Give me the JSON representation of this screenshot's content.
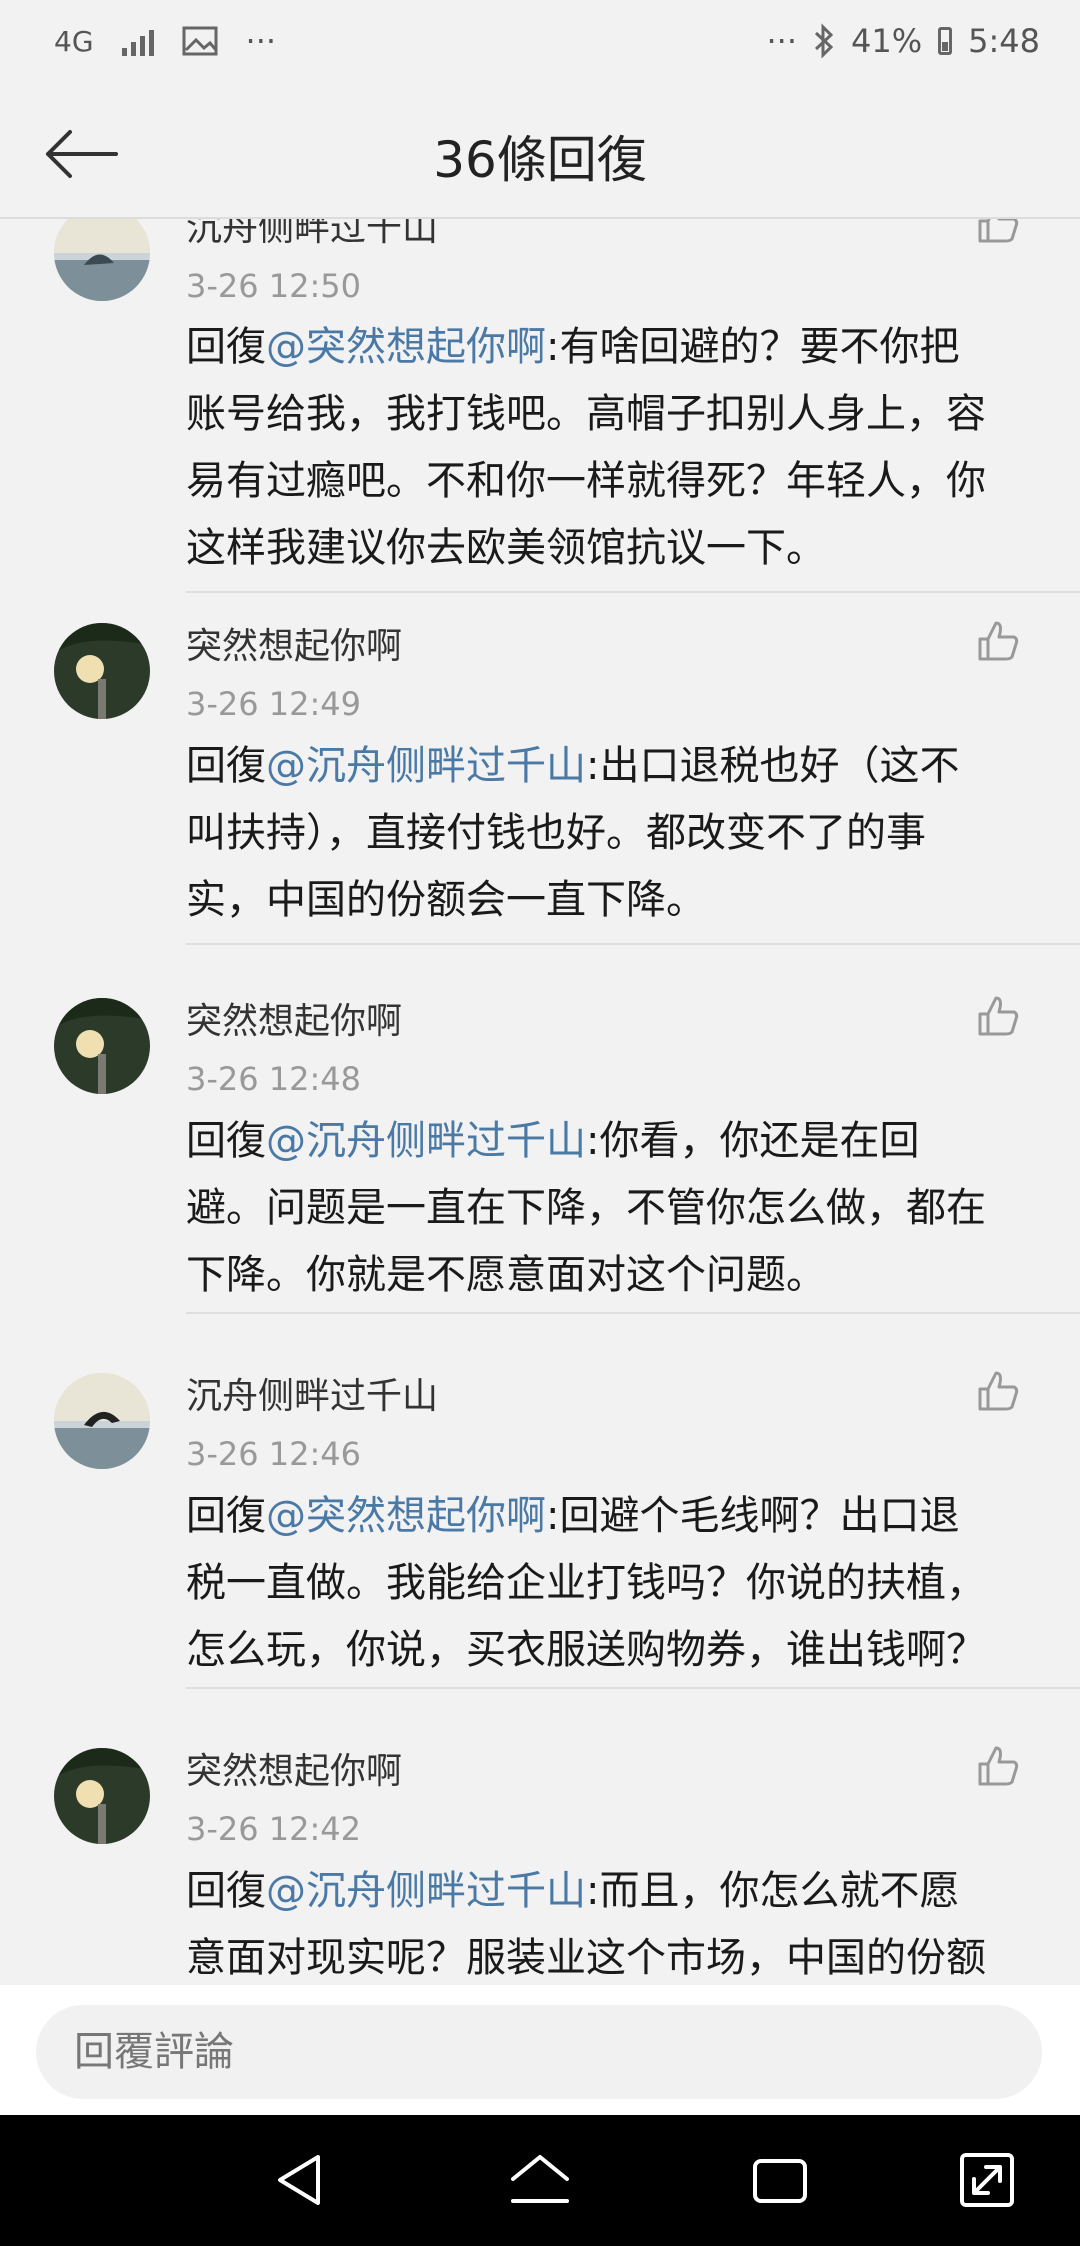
{
  "status_bar": {
    "network": "4G",
    "more_left": "···",
    "more_right": "···",
    "battery": "41%",
    "time": "5:48"
  },
  "header": {
    "title": "36條回復"
  },
  "comments": [
    {
      "author": "沉舟侧畔过千山",
      "time": "3-26 12:50",
      "reply_prefix": "回復",
      "mention": "@突然想起你啊",
      "text": ":有啥回避的？要不你把",
      "lines": [
        "账号给我，我打钱吧。高帽子扣别人身上，容",
        "易有过瘾吧。不和你一样就得死？年轻人，你",
        "这样我建议你去欧美领馆抗议一下。"
      ]
    },
    {
      "author": "突然想起你啊",
      "time": "3-26 12:49",
      "reply_prefix": "回復",
      "mention": "@沉舟侧畔过千山",
      "text": ":出口退税也好（这不",
      "lines": [
        "叫扶持），直接付钱也好。都改变不了的事",
        "实，中国的份额会一直下降。"
      ]
    },
    {
      "author": "突然想起你啊",
      "time": "3-26 12:48",
      "reply_prefix": "回復",
      "mention": "@沉舟侧畔过千山",
      "text": ":你看，你还是在回",
      "lines": [
        "避。问题是一直在下降，不管你怎么做，都在",
        "下降。你就是不愿意面对这个问题。"
      ]
    },
    {
      "author": "沉舟侧畔过千山",
      "time": "3-26 12:46",
      "reply_prefix": "回復",
      "mention": "@突然想起你啊",
      "text": ":回避个毛线啊？出口退",
      "lines": [
        "税一直做。我能给企业打钱吗？你说的扶植，",
        "怎么玩，你说，买衣服送购物券，谁出钱啊？"
      ]
    },
    {
      "author": "突然想起你啊",
      "time": "3-26 12:42",
      "reply_prefix": "回復",
      "mention": "@沉舟侧畔过千山",
      "text": ":而且，你怎么就不愿",
      "lines": [
        "意面对现实呢？服装业这个市场，中国的份额"
      ]
    }
  ],
  "reply_bar": {
    "placeholder": "回覆評論"
  },
  "icons": {
    "back": "arrow-left-icon",
    "like": "thumbs-up-icon",
    "nav_back": "triangle-back-icon",
    "nav_home": "home-icon",
    "nav_recent": "recent-apps-icon",
    "nav_expand": "expand-icon"
  }
}
